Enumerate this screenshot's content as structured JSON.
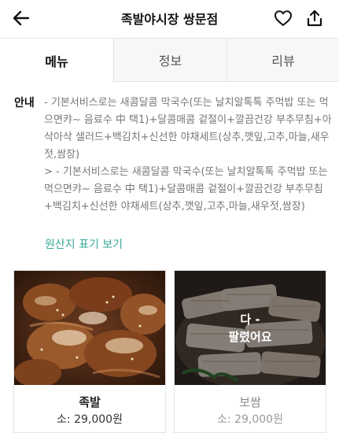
{
  "header": {
    "title": "족발야시장 쌍문점",
    "back_icon": "arrow-left-icon",
    "favorite_icon": "heart-icon",
    "share_icon": "share-icon"
  },
  "tabs": [
    {
      "label": "메뉴",
      "active": true
    },
    {
      "label": "정보",
      "active": false
    },
    {
      "label": "리뷰",
      "active": false
    }
  ],
  "notice": {
    "label": "안내",
    "lines": [
      "- 기본서비스로는 새콤달콤 막국수(또는 날치알톡톡 주먹밥 또는 먹으면캬~ 음료수 中 택1)+달콤매콤 겉절이+깔끔건강 부추무침+아삭아삭 샐러드+백김치+신선한 야채세트(상추,깻잎,고추,마늘,새우젓,쌈장)",
      "> - 기본서비스로는 새콤달콤 막국수(또는 날치알톡톡 주먹밥 또는 먹으면캬~ 음료수 中 택1)+달콤매콤 겉절이+깔끔건강 부추무침+백김치+신선한 야채세트(상추,깻잎,고추,마늘,새우젓,쌈장)"
    ]
  },
  "origin_link": "원산지 표기 보기",
  "menu_items": [
    {
      "name": "족발",
      "price": "소: 29,000원",
      "sold_out": false
    },
    {
      "name": "보쌈",
      "price": "소: 29,000원",
      "sold_out": true,
      "sold_line1": "다 -",
      "sold_line2": "팔렸어요"
    }
  ],
  "colors": {
    "accent": "#3aa99a",
    "text": "#222222",
    "muted": "#777777"
  }
}
